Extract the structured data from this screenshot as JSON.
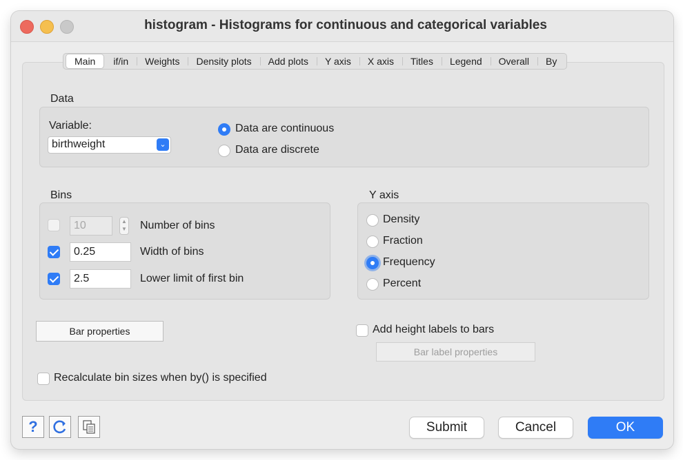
{
  "window": {
    "title": "histogram - Histograms for continuous and categorical variables"
  },
  "tabs": [
    {
      "label": "Main",
      "active": true
    },
    {
      "label": "if/in"
    },
    {
      "label": "Weights"
    },
    {
      "label": "Density plots"
    },
    {
      "label": "Add plots"
    },
    {
      "label": "Y axis"
    },
    {
      "label": "X axis"
    },
    {
      "label": "Titles"
    },
    {
      "label": "Legend"
    },
    {
      "label": "Overall"
    },
    {
      "label": "By"
    }
  ],
  "data_section": {
    "title": "Data",
    "variable_label": "Variable:",
    "variable_value": "birthweight",
    "continuous_label": "Data are continuous",
    "discrete_label": "Data are discrete",
    "selected": "continuous"
  },
  "bins_section": {
    "title": "Bins",
    "number_of_bins": {
      "checked": false,
      "value": "10",
      "label": "Number of bins"
    },
    "width_of_bins": {
      "checked": true,
      "value": "0.25",
      "label": "Width of bins"
    },
    "lower_limit": {
      "checked": true,
      "value": "2.5",
      "label": "Lower limit of first bin"
    }
  },
  "y_axis_section": {
    "title": "Y axis",
    "options": [
      "Density",
      "Fraction",
      "Frequency",
      "Percent"
    ],
    "selected": "Frequency"
  },
  "bar_properties_label": "Bar properties",
  "height_labels": {
    "label": "Add height labels to bars",
    "checked": false
  },
  "bar_label_properties_label": "Bar label properties",
  "recalculate": {
    "label": "Recalculate bin sizes when by() is specified",
    "checked": false
  },
  "footer": {
    "help_icon": "?",
    "reset_icon": "reset-icon",
    "copy_icon": "copy-icon",
    "submit_label": "Submit",
    "cancel_label": "Cancel",
    "ok_label": "OK"
  },
  "colors": {
    "accent": "#2f7cf6",
    "close": "#ed6a5e",
    "minimize": "#f5bf4f"
  }
}
